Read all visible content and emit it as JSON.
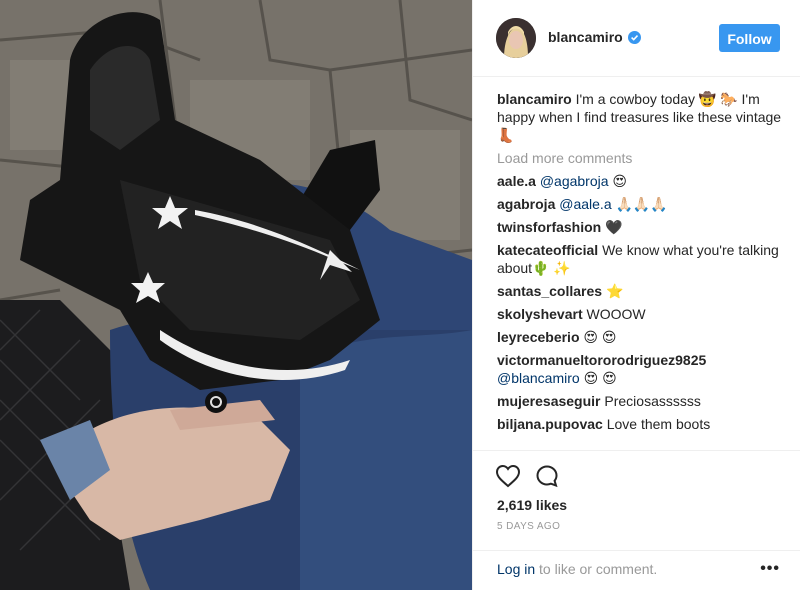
{
  "header": {
    "username": "blancamiro",
    "follow_label": "Follow"
  },
  "caption": {
    "username": "blancamiro",
    "text": "I'm a cowboy today 🤠 🐎 I'm happy when I find treasures like these vintage👢"
  },
  "load_more": "Load more comments",
  "comments": [
    {
      "user": "aale.a",
      "mention": "@agabroja",
      "text": "😍"
    },
    {
      "user": "agabroja",
      "mention": "@aale.a",
      "text": "🙏🏻🙏🏻🙏🏻"
    },
    {
      "user": "twinsforfashion",
      "mention": "",
      "text": "🖤"
    },
    {
      "user": "katecateofficial",
      "mention": "",
      "text": "We know what you're talking about🌵 ✨"
    },
    {
      "user": "santas_collares",
      "mention": "",
      "text": "⭐"
    },
    {
      "user": "skolyshevart",
      "mention": "",
      "text": "WOOOW"
    },
    {
      "user": "leyreceberio",
      "mention": "",
      "text": "😍 😍"
    },
    {
      "user": "victormanueltororodriguez9825",
      "mention": "@blancamiro",
      "text": "😍 😍"
    },
    {
      "user": "mujeresaseguir",
      "mention": "",
      "text": "Preciosassssss"
    },
    {
      "user": "biljana.pupovac",
      "mention": "",
      "text": "Love them boots"
    }
  ],
  "likes": "2,619 likes",
  "time": "5 DAYS AGO",
  "login": {
    "link": "Log in",
    "rest": " to like or comment."
  },
  "more_label": "•••",
  "icons": {
    "like": "heart-icon",
    "comment": "comment-icon",
    "verified": "verified-badge-icon",
    "more": "more-options-icon"
  },
  "colors": {
    "follow_button": "#3897f0",
    "link": "#003569",
    "muted": "#999999",
    "text": "#262626"
  }
}
